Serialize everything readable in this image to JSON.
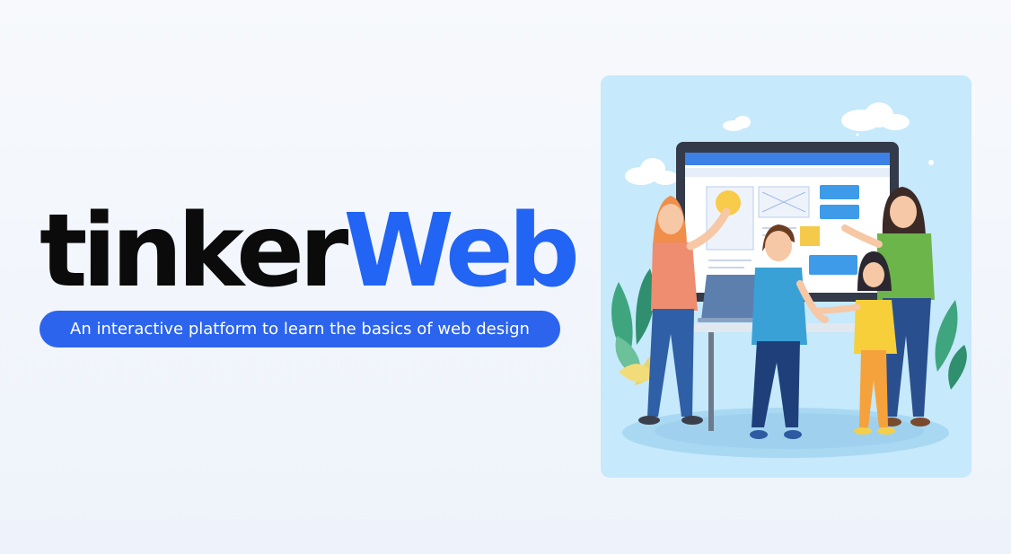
{
  "brand": {
    "name_part1": "tinker",
    "name_part2": "Web",
    "tagline": "An interactive platform to learn the basics of web design"
  },
  "colors": {
    "accent": "#2264f4",
    "pill": "#2c64ee",
    "text_dark": "#0b0b0c",
    "illustration_bg": "#c6e9fb"
  },
  "illustration": {
    "icon": "people-at-computer-illustration"
  }
}
